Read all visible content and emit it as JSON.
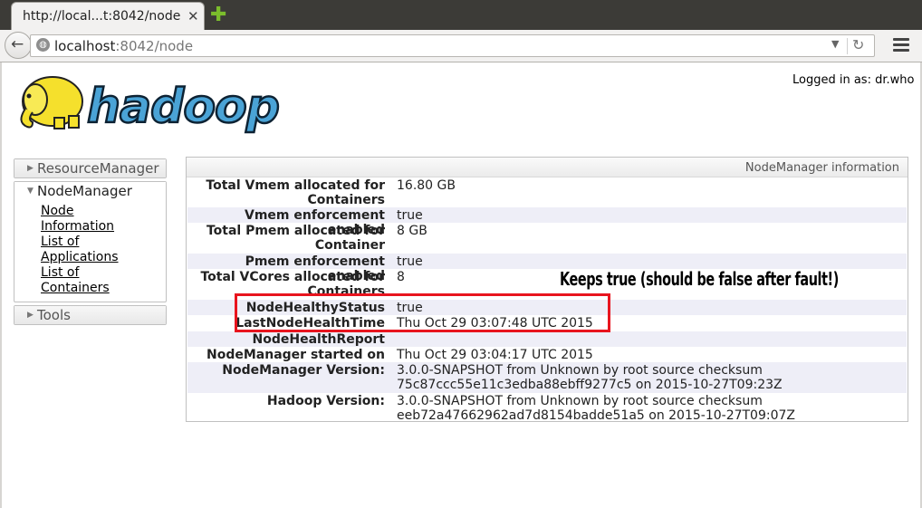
{
  "browser": {
    "tab_title": "http://local...t:8042/node",
    "tab_close": "✕",
    "new_tab": "✚",
    "url_host": "localhost",
    "url_rest": ":8042/node"
  },
  "header": {
    "logged_in": "Logged in as: dr.who",
    "logo_text": "hadoop"
  },
  "nav": {
    "resource_manager": "ResourceManager",
    "node_manager": "NodeManager",
    "links": [
      "Node",
      "Information",
      "List of",
      "Applications",
      "List of",
      "Containers"
    ],
    "tools": "Tools"
  },
  "info": {
    "title": "NodeManager information",
    "rows": [
      {
        "key1": "Total Vmem allocated for",
        "key2": "Containers",
        "value": "16.80 GB"
      },
      {
        "key1": "Vmem enforcement enabled",
        "value": "true"
      },
      {
        "key1": "Total Pmem allocated for",
        "key2": "Container",
        "value": "8 GB"
      },
      {
        "key1": "Pmem enforcement enabled",
        "value": "true"
      },
      {
        "key1": "Total VCores allocated for",
        "key2": "Containers",
        "value": "8"
      },
      {
        "key1": "NodeHealthyStatus",
        "value": "true"
      },
      {
        "key1": "LastNodeHealthTime",
        "value": "Thu Oct 29 03:07:48 UTC 2015"
      },
      {
        "key1": "NodeHealthReport",
        "value": ""
      },
      {
        "key1": "NodeManager started on",
        "value": "Thu Oct 29 03:04:17 UTC 2015"
      },
      {
        "key1": "NodeManager Version:",
        "value": "3.0.0-SNAPSHOT from Unknown by root source checksum",
        "value2": "75c87ccc55e11c3edba88ebff9277c5 on 2015-10-27T09:23Z"
      },
      {
        "key1": "Hadoop Version:",
        "value": "3.0.0-SNAPSHOT from Unknown by root source checksum",
        "value2": "eeb72a47662962ad7d8154badde51a5 on 2015-10-27T09:07Z"
      }
    ]
  },
  "annotation": "Keeps true  (should be false after fault!)",
  "colors": {
    "highlight": "#e8141e",
    "logo_blue": "#4aa3d6",
    "logo_yellow": "#f5e02c"
  }
}
